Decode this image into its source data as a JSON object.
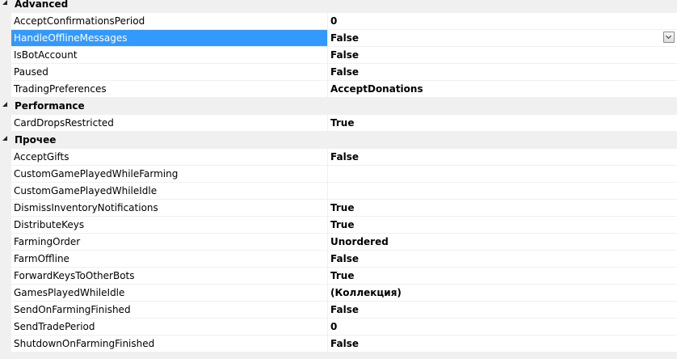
{
  "categories": [
    {
      "label": "Advanced",
      "props": [
        {
          "name": "AcceptConfirmationsPeriod",
          "value": "0"
        },
        {
          "name": "HandleOfflineMessages",
          "value": "False",
          "selected": true,
          "dropdown": true
        },
        {
          "name": "IsBotAccount",
          "value": "False"
        },
        {
          "name": "Paused",
          "value": "False"
        },
        {
          "name": "TradingPreferences",
          "value": "AcceptDonations"
        }
      ]
    },
    {
      "label": "Performance",
      "props": [
        {
          "name": "CardDropsRestricted",
          "value": "True"
        }
      ]
    },
    {
      "label": "Прочее",
      "props": [
        {
          "name": "AcceptGifts",
          "value": "False"
        },
        {
          "name": "CustomGamePlayedWhileFarming",
          "value": ""
        },
        {
          "name": "CustomGamePlayedWhileIdle",
          "value": ""
        },
        {
          "name": "DismissInventoryNotifications",
          "value": "True"
        },
        {
          "name": "DistributeKeys",
          "value": "True"
        },
        {
          "name": "FarmingOrder",
          "value": "Unordered"
        },
        {
          "name": "FarmOffline",
          "value": "False"
        },
        {
          "name": "ForwardKeysToOtherBots",
          "value": "True"
        },
        {
          "name": "GamesPlayedWhileIdle",
          "value": "(Коллекция)"
        },
        {
          "name": "SendOnFarmingFinished",
          "value": "False"
        },
        {
          "name": "SendTradePeriod",
          "value": "0"
        },
        {
          "name": "ShutdownOnFarmingFinished",
          "value": "False"
        }
      ]
    }
  ],
  "icons": {
    "expand": "collapse-triangle-icon",
    "dropdown": "chevron-down-icon"
  },
  "colors": {
    "selection": "#3399ff",
    "category_bg": "#f0f0f0",
    "cell_bg": "#ffffff"
  }
}
